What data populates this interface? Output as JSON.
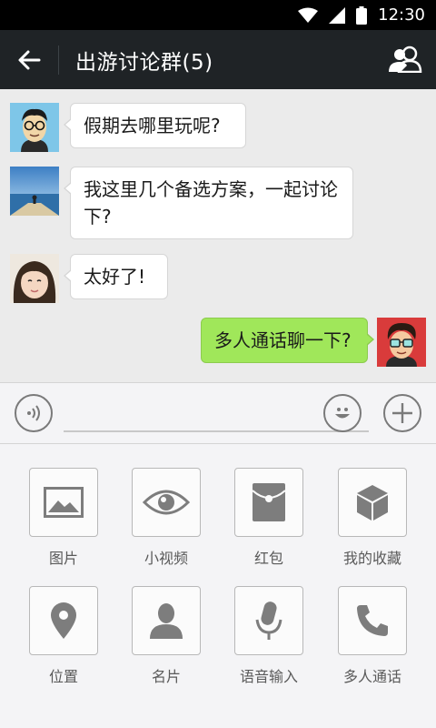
{
  "status_bar": {
    "time": "12:30"
  },
  "header": {
    "title": "出游讨论群(5)"
  },
  "messages": [
    {
      "side": "left",
      "text": "假期去哪里玩呢?"
    },
    {
      "side": "left",
      "text": "我这里几个备选方案，一起讨论下?"
    },
    {
      "side": "left",
      "text": "太好了!"
    },
    {
      "side": "right",
      "text": "多人通话聊一下?"
    }
  ],
  "input_bar": {
    "value": ""
  },
  "tools": [
    {
      "label": "图片",
      "icon": "image-icon"
    },
    {
      "label": "小视频",
      "icon": "eye-icon"
    },
    {
      "label": "红包",
      "icon": "red-envelope-icon"
    },
    {
      "label": "我的收藏",
      "icon": "cube-icon"
    },
    {
      "label": "位置",
      "icon": "location-pin-icon"
    },
    {
      "label": "名片",
      "icon": "person-icon"
    },
    {
      "label": "语音输入",
      "icon": "microphone-icon"
    },
    {
      "label": "多人通话",
      "icon": "phone-icon"
    }
  ],
  "colors": {
    "header_bg": "#1f2326",
    "chat_bg": "#ebebeb",
    "my_bubble": "#a0e75a",
    "icon_gray": "#7d7d7d"
  }
}
